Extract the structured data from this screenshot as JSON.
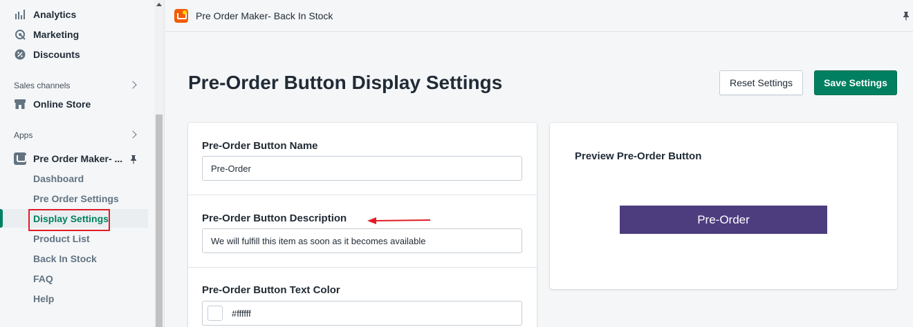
{
  "sidebar": {
    "nav": [
      {
        "label": "Analytics",
        "icon": "analytics-icon"
      },
      {
        "label": "Marketing",
        "icon": "marketing-icon"
      },
      {
        "label": "Discounts",
        "icon": "discounts-icon"
      }
    ],
    "sales_channels_label": "Sales channels",
    "online_store_label": "Online Store",
    "apps_label": "Apps",
    "app_name": "Pre Order Maker- ...",
    "sub_items": [
      "Dashboard",
      "Pre Order Settings",
      "Display Settings",
      "Product List",
      "Back In Stock",
      "FAQ",
      "Help"
    ],
    "active_sub_item": "Display Settings"
  },
  "topbar": {
    "app_title": "Pre Order Maker- Back In Stock"
  },
  "main": {
    "page_title": "Pre-Order Button Display Settings",
    "reset_label": "Reset Settings",
    "save_label": "Save Settings",
    "fields": {
      "name_label": "Pre-Order Button Name",
      "name_value": "Pre-Order",
      "description_label": "Pre-Order Button Description",
      "description_value": "We will fulfill this item as soon as it becomes available",
      "text_color_label": "Pre-Order Button Text Color",
      "text_color_value": "#ffffff"
    },
    "preview": {
      "label": "Preview Pre-Order Button",
      "button_text": "Pre-Order",
      "button_bg": "#4d3d7f",
      "button_text_color": "#ffffff"
    }
  },
  "colors": {
    "accent": "#008060",
    "annotation_red": "#e01b24"
  }
}
